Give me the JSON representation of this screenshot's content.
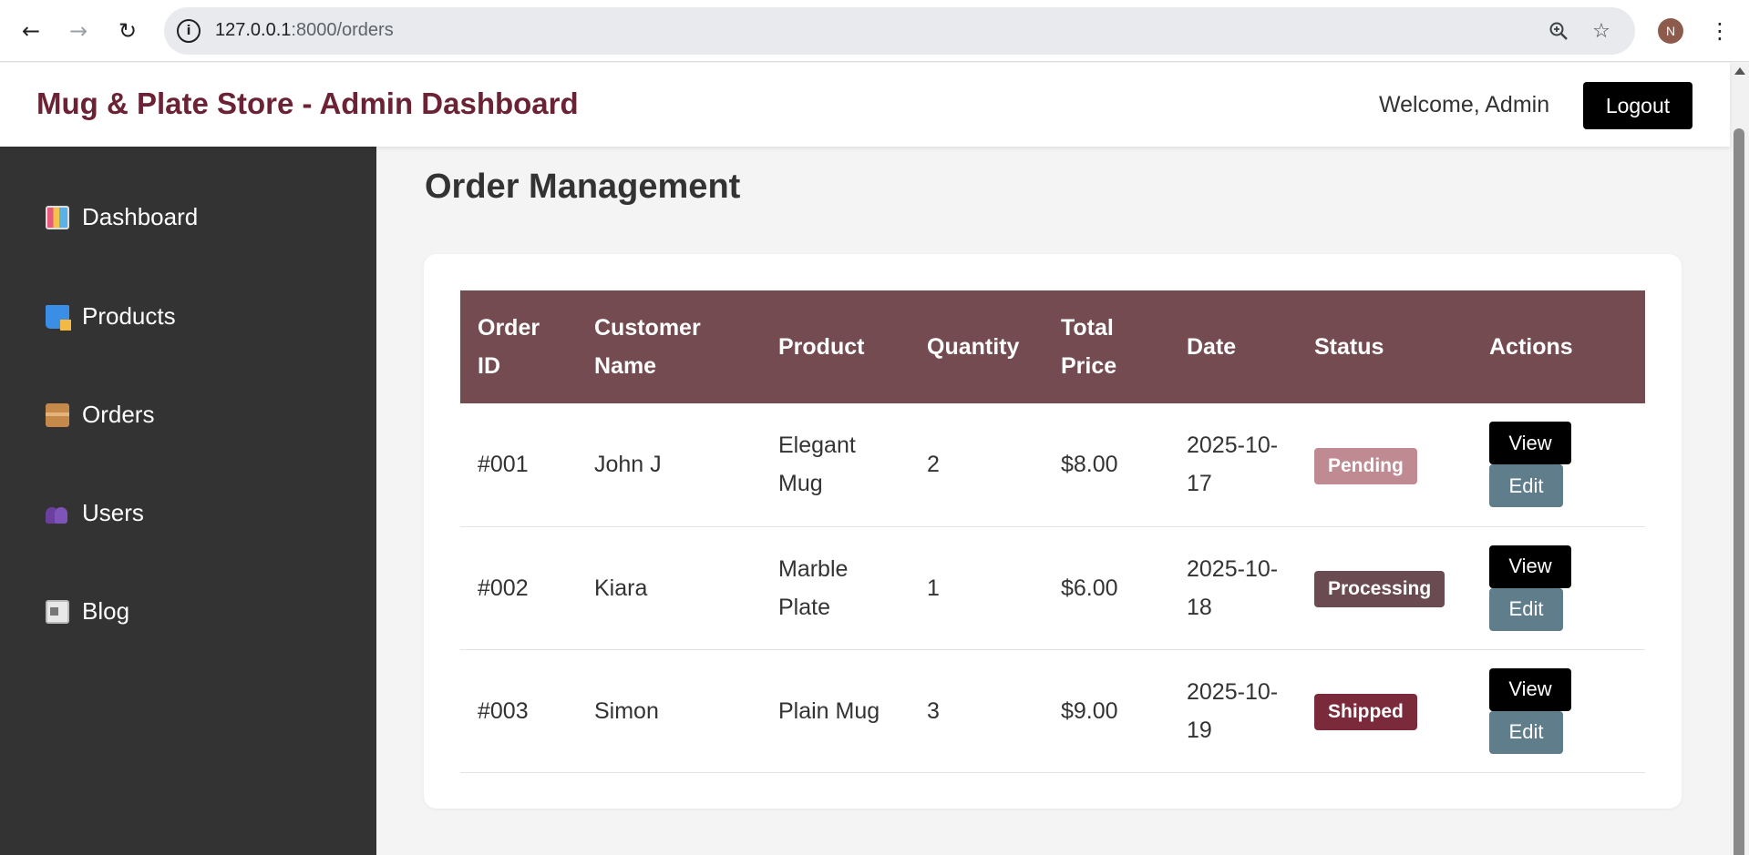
{
  "browser": {
    "url_host": "127.0.0.1",
    "url_path": ":8000/orders",
    "profile_initial": "N"
  },
  "header": {
    "title": "Mug & Plate Store - Admin Dashboard",
    "welcome": "Welcome, Admin",
    "logout_label": "Logout"
  },
  "sidebar": {
    "items": [
      {
        "label": "Dashboard",
        "icon": "bar-chart-icon"
      },
      {
        "label": "Products",
        "icon": "shopping-bags-icon"
      },
      {
        "label": "Orders",
        "icon": "package-icon"
      },
      {
        "label": "Users",
        "icon": "users-icon"
      },
      {
        "label": "Blog",
        "icon": "newspaper-icon"
      }
    ]
  },
  "main": {
    "title": "Order Management",
    "table": {
      "headers": [
        "Order ID",
        "Customer Name",
        "Product",
        "Quantity",
        "Total Price",
        "Date",
        "Status",
        "Actions"
      ],
      "rows": [
        {
          "id": "#001",
          "customer": "John J",
          "product": "Elegant Mug",
          "quantity": "2",
          "total": "$8.00",
          "date": "2025-10-17",
          "status": "Pending",
          "status_color": "#c08a93",
          "view": "View",
          "edit": "Edit"
        },
        {
          "id": "#002",
          "customer": "Kiara",
          "product": "Marble Plate",
          "quantity": "1",
          "total": "$6.00",
          "date": "2025-10-18",
          "status": "Processing",
          "status_color": "#6b4b52",
          "view": "View",
          "edit": "Edit"
        },
        {
          "id": "#003",
          "customer": "Simon",
          "product": "Plain Mug",
          "quantity": "3",
          "total": "$9.00",
          "date": "2025-10-19",
          "status": "Shipped",
          "status_color": "#7a2a3a",
          "view": "View",
          "edit": "Edit"
        }
      ]
    }
  },
  "colors": {
    "brand": "#6b2234",
    "table_header": "#734b50",
    "sidebar": "#333333",
    "edit_button": "#607d8b"
  }
}
